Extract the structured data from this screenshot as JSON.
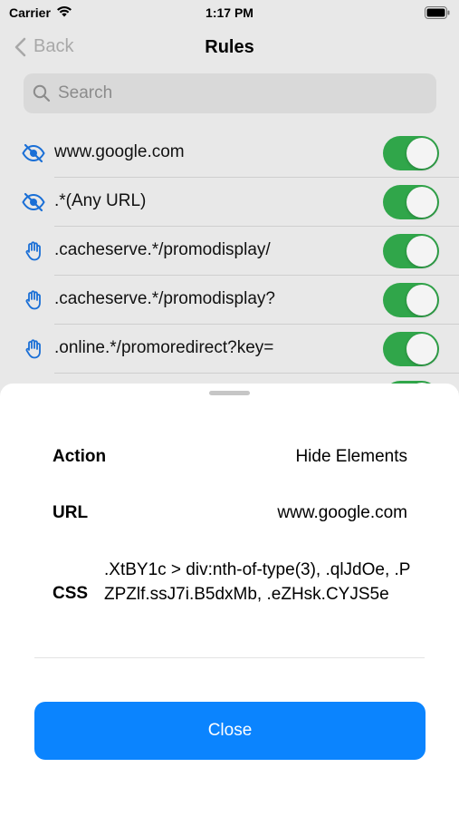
{
  "status_bar": {
    "carrier": "Carrier",
    "time": "1:17 PM"
  },
  "nav": {
    "back_label": "Back",
    "title": "Rules"
  },
  "search": {
    "placeholder": "Search"
  },
  "rules": [
    {
      "icon": "eye-slash-icon",
      "label": "www.google.com",
      "enabled": true
    },
    {
      "icon": "eye-slash-icon",
      "label": ".*(Any URL)",
      "enabled": true
    },
    {
      "icon": "hand-icon",
      "label": ".cacheserve.*/promodisplay/",
      "enabled": true
    },
    {
      "icon": "hand-icon",
      "label": ".cacheserve.*/promodisplay?",
      "enabled": true
    },
    {
      "icon": "hand-icon",
      "label": ".online.*/promoredirect?key=",
      "enabled": true
    }
  ],
  "sheet": {
    "action_key": "Action",
    "action_value": "Hide Elements",
    "url_key": "URL",
    "url_value": "www.google.com",
    "css_key": "CSS",
    "css_value": ".XtBY1c > div:nth-of-type(3), .qlJdOe, .PZPZlf.ssJ7i.B5dxMb, .eZHsk.CYJS5e",
    "close_label": "Close"
  },
  "colors": {
    "accent": "#0b84fe",
    "toggle_on": "#30a64a",
    "icon_blue": "#1a6fd6"
  }
}
